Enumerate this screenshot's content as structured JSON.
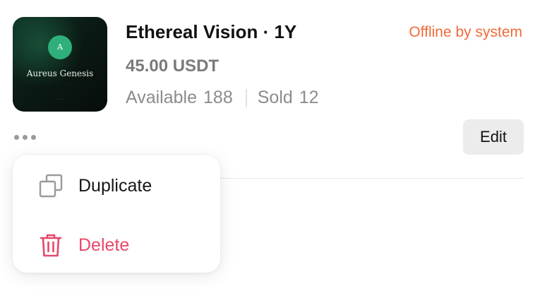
{
  "product": {
    "thumbnail": {
      "seal_letter": "A",
      "name": "Aureus Genesis"
    },
    "title": "Ethereal Vision · 1Y",
    "status": "Offline by system",
    "price": "45.00 USDT",
    "available_label": "Available",
    "available_count": "188",
    "sold_label": "Sold",
    "sold_count": "12"
  },
  "actions": {
    "more_icon": "more-horizontal-icon",
    "edit_label": "Edit"
  },
  "menu": {
    "duplicate_label": "Duplicate",
    "duplicate_icon": "duplicate-icon",
    "delete_label": "Delete",
    "delete_icon": "trash-icon"
  },
  "colors": {
    "status": "#f06a3a",
    "delete": "#e8476a",
    "thumbnail_accent": "#2fb07a"
  }
}
